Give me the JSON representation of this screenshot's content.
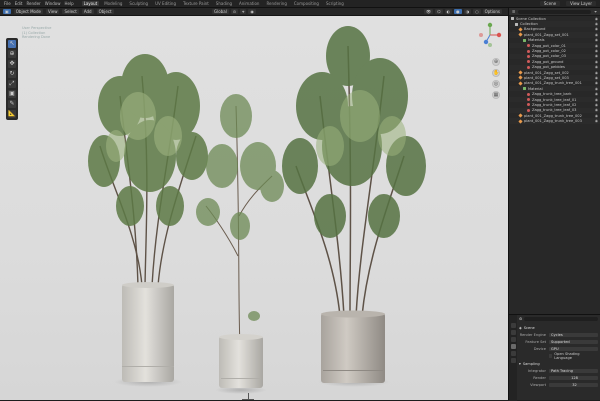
{
  "topbar": {
    "menu": [
      "File",
      "Edit",
      "Render",
      "Window",
      "Help"
    ],
    "workspaces": [
      "Layout",
      "Modeling",
      "Sculpting",
      "UV Editing",
      "Texture Paint",
      "Shading",
      "Animation",
      "Rendering",
      "Compositing",
      "Scripting"
    ],
    "active_workspace": "Layout",
    "scene": "Scene",
    "view_layer": "View Layer"
  },
  "toolbar": {
    "orientation": "Global",
    "options_label": "Options"
  },
  "viewport_header": {
    "mode": "Object Mode",
    "view": "View",
    "select": "Select",
    "add": "Add",
    "object": "Object"
  },
  "viewport_info": {
    "line1": "User Perspective",
    "line2": "(1) Collection",
    "line3": "Rendering Done"
  },
  "outliner": {
    "title": "Scene Collection",
    "rows": [
      {
        "label": "Scene Collection",
        "indent": 0,
        "icon": "coll"
      },
      {
        "label": "Collection",
        "indent": 1,
        "icon": "coll"
      },
      {
        "label": "Background",
        "indent": 2,
        "icon": "obj"
      },
      {
        "label": "plant_001_Zagg_set_001",
        "indent": 2,
        "icon": "obj"
      },
      {
        "label": "Materials",
        "indent": 3,
        "icon": "grp"
      },
      {
        "label": "Zagg_pot_color_01",
        "indent": 4,
        "icon": "mat"
      },
      {
        "label": "Zagg_pot_color_02",
        "indent": 4,
        "icon": "mat"
      },
      {
        "label": "Zagg_pot_color_03",
        "indent": 4,
        "icon": "mat"
      },
      {
        "label": "Zagg_pot_ground",
        "indent": 4,
        "icon": "mat"
      },
      {
        "label": "Zagg_pot_pebbles",
        "indent": 4,
        "icon": "mat"
      },
      {
        "label": "plant_001_Zagg_set_002",
        "indent": 2,
        "icon": "obj"
      },
      {
        "label": "plant_001_Zagg_set_003",
        "indent": 2,
        "icon": "obj"
      },
      {
        "label": "plant_001_Zagg_trunk_tree_001",
        "indent": 2,
        "icon": "obj"
      },
      {
        "label": "Material",
        "indent": 3,
        "icon": "grp"
      },
      {
        "label": "Zagg_trunk_tree_bark",
        "indent": 4,
        "icon": "mat"
      },
      {
        "label": "Zagg_trunk_tree_leaf_01",
        "indent": 4,
        "icon": "mat"
      },
      {
        "label": "Zagg_trunk_tree_leaf_02",
        "indent": 4,
        "icon": "mat"
      },
      {
        "label": "Zagg_trunk_tree_leaf_03",
        "indent": 4,
        "icon": "mat"
      },
      {
        "label": "plant_001_Zagg_trunk_tree_002",
        "indent": 2,
        "icon": "obj"
      },
      {
        "label": "plant_001_Zagg_trunk_tree_003",
        "indent": 2,
        "icon": "obj"
      }
    ]
  },
  "properties": {
    "context": "Scene",
    "render_engine_label": "Render Engine",
    "render_engine": "Cycles",
    "feature_set_label": "Feature Set",
    "feature_set": "Supported",
    "device_label": "Device",
    "device": "GPU",
    "osl_label": "Open Shading Language",
    "sampling_label": "Sampling",
    "integrator_label": "Integrator",
    "integrator": "Path Tracing",
    "render_label": "Render",
    "render_samples": "128",
    "viewport_label": "Viewport",
    "viewport_samples": "32"
  }
}
